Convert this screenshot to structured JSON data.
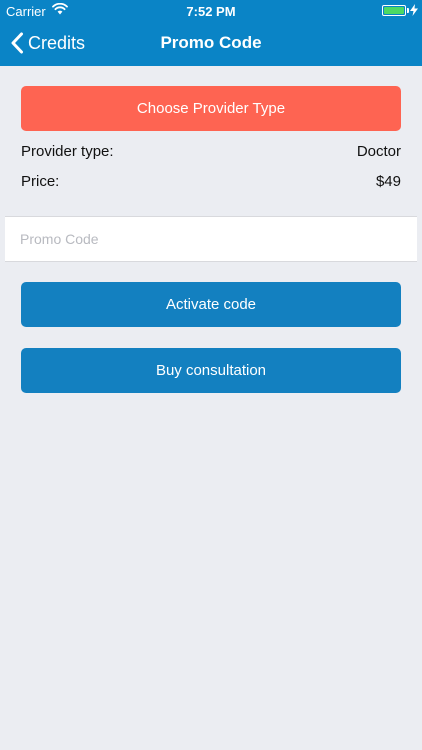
{
  "status_bar": {
    "carrier": "Carrier",
    "time": "7:52 PM",
    "battery_color": "#4cd964"
  },
  "nav": {
    "back_label": "Credits",
    "back_icon": "chevron-left-icon",
    "title": "Promo Code",
    "bar_color": "#0a84c6"
  },
  "provider": {
    "choose_button_label": "Choose Provider Type",
    "choose_button_color": "#fe6452",
    "type_label": "Provider type:",
    "type_value": "Doctor",
    "price_label": "Price:",
    "price_value": "$49"
  },
  "promo": {
    "placeholder": "Promo Code",
    "value": ""
  },
  "actions": {
    "activate_label": "Activate code",
    "buy_label": "Buy consultation",
    "button_color": "#1380c0"
  }
}
